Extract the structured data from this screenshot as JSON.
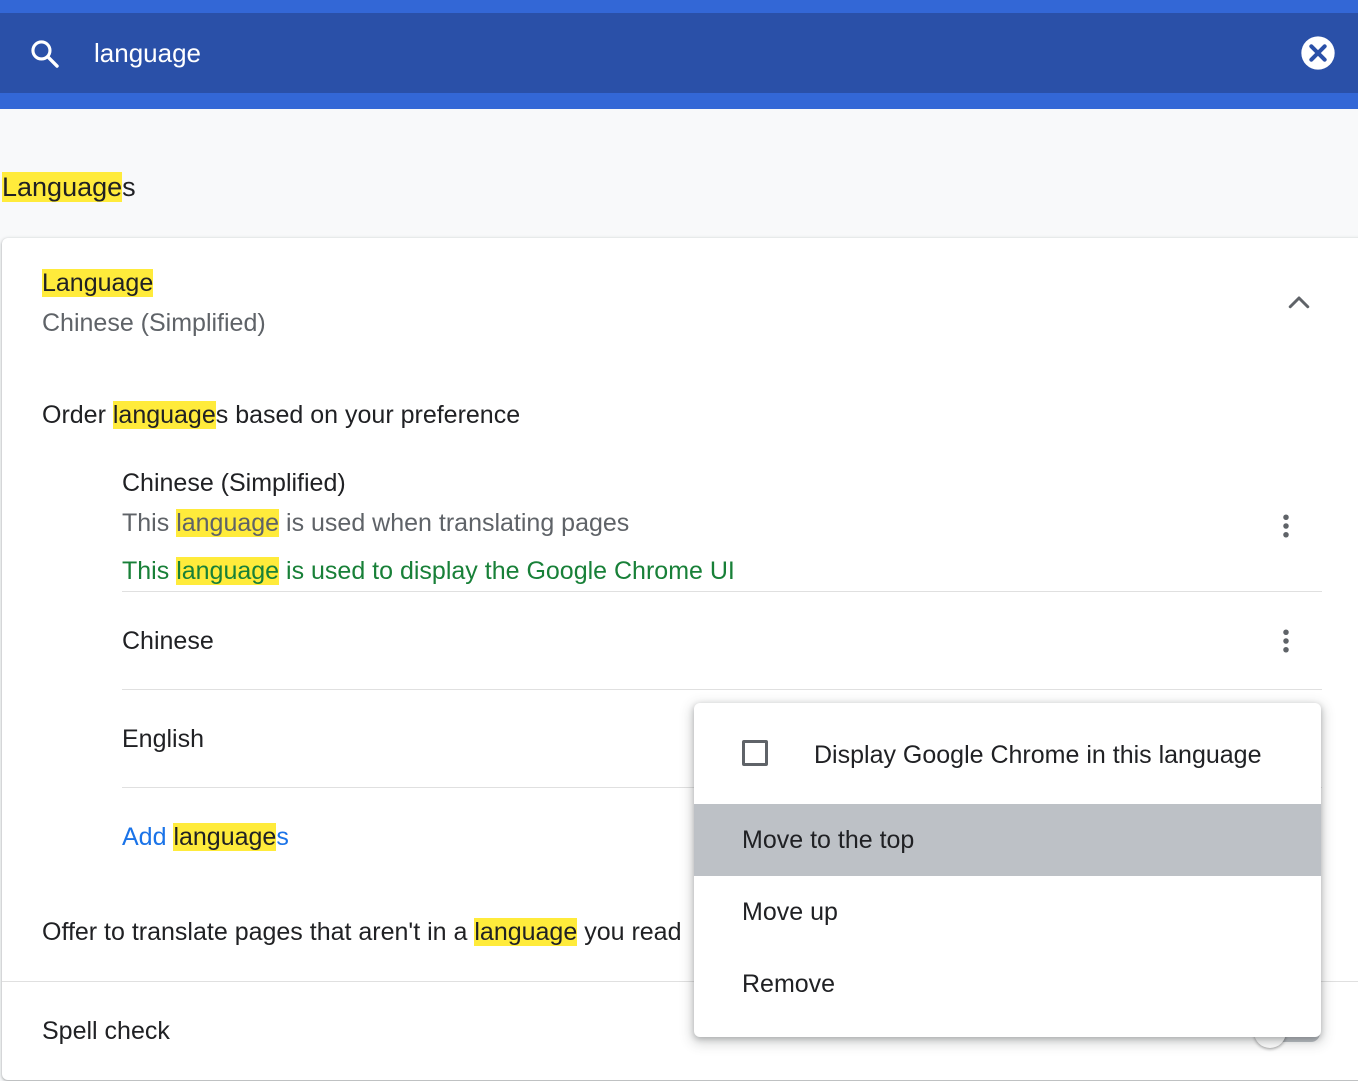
{
  "search": {
    "value": "language",
    "placeholder": "Search settings"
  },
  "icons": {
    "search": "search-icon",
    "clear": "close-circle-icon",
    "collapse": "chevron-up-icon",
    "more": "more-vert-icon"
  },
  "colors": {
    "accent_blue": "#3367d6",
    "search_bar": "#2a50a8",
    "highlight": "#ffeb3b",
    "link": "#1a73e8",
    "green_note": "#188038"
  },
  "section": {
    "title_hl": "Language",
    "title_rest": "s"
  },
  "language_row": {
    "title": "Language",
    "current": "Chinese (Simplified)"
  },
  "order": {
    "prefix": "Order ",
    "hl": "language",
    "suffix": "s based on your preference"
  },
  "languages": [
    {
      "name": "Chinese (Simplified)",
      "note_prefix": "This ",
      "note_hl": "language",
      "note_suffix": " is used when translating pages",
      "ui_prefix": "This ",
      "ui_hl": "language",
      "ui_suffix": " is used to display the Google Chrome UI"
    },
    {
      "name": "Chinese"
    },
    {
      "name": "English"
    }
  ],
  "add_languages": {
    "prefix": "Add ",
    "hl": "language",
    "suffix": "s"
  },
  "offer_translate": {
    "prefix": "Offer to translate pages that aren't in a ",
    "hl": "language",
    "suffix": " you read"
  },
  "spell_check": {
    "label": "Spell check"
  },
  "menu": {
    "checkbox_label": "Display Google Chrome in this language",
    "checkbox_checked": false,
    "items": [
      "Move to the top",
      "Move up",
      "Remove"
    ],
    "active_index": 0
  }
}
